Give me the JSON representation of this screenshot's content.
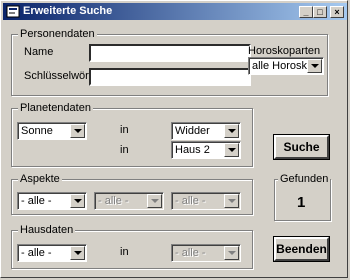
{
  "window": {
    "title": "Erweiterte Suche",
    "minimize": "_",
    "maximize": "□",
    "close": "×"
  },
  "personendaten": {
    "legend": "Personendaten",
    "name_label": "Name",
    "keywords_label": "Schlüsselwörter",
    "name_value": "",
    "keywords_value": "",
    "horoskoparten_label": "Horoskoparten",
    "horoskoparten_value": "alle Horoskopar"
  },
  "planetendaten": {
    "legend": "Planetendaten",
    "planet_value": "Sonne",
    "in_label_1": "in",
    "sign_value": "Widder",
    "in_label_2": "in",
    "house_value": "Haus 2"
  },
  "aspekte": {
    "legend": "Aspekte",
    "first_value": "- alle -",
    "second_value": "- alle -",
    "third_value": "- alle -"
  },
  "hausdaten": {
    "legend": "Hausdaten",
    "first_value": "- alle -",
    "in_label": "in",
    "second_value": "- alle -"
  },
  "gefunden": {
    "legend": "Gefunden",
    "count": "1"
  },
  "buttons": {
    "search": "Suche",
    "exit": "Beenden"
  }
}
